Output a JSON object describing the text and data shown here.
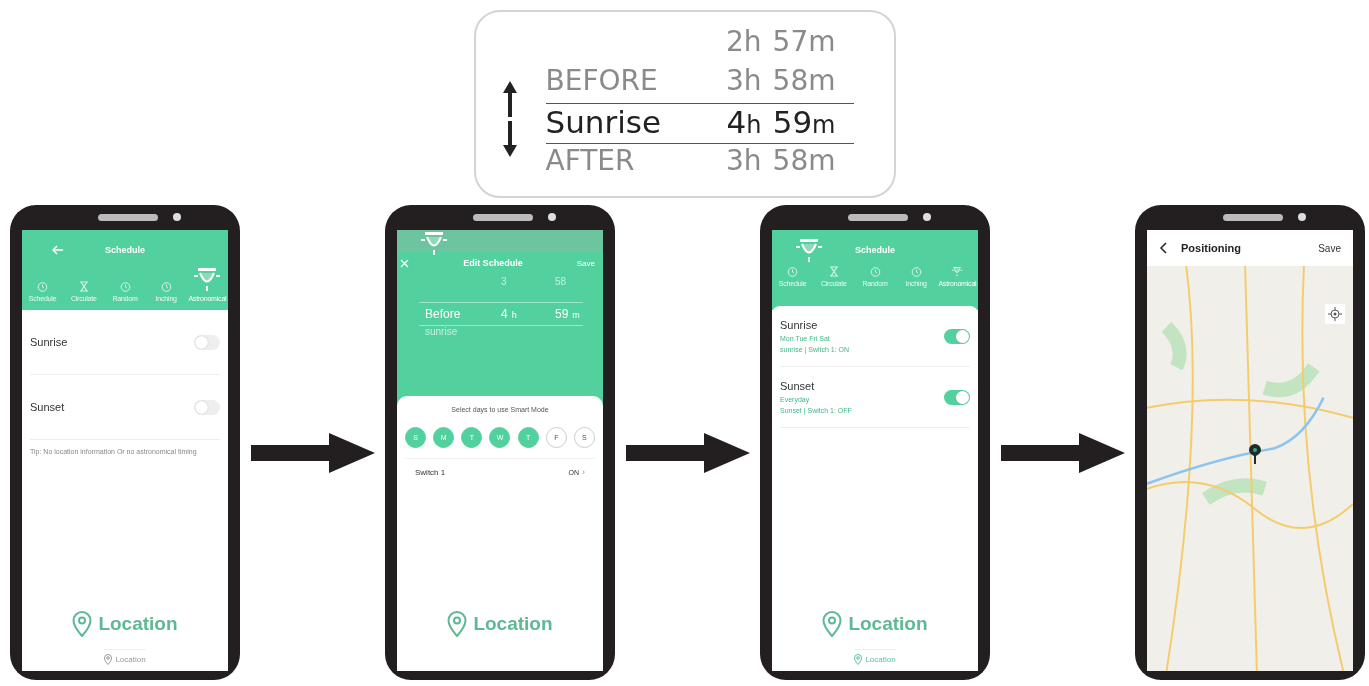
{
  "callout": {
    "rows": [
      {
        "hours": "2",
        "hour_unit": "h",
        "minutes": "57",
        "minute_unit": "m",
        "selected": false
      },
      {
        "label": "BEFORE",
        "hours": "3",
        "hour_unit": "h",
        "minutes": "58",
        "minute_unit": "m",
        "selected": false
      },
      {
        "label": "Sunrise",
        "hours": "4",
        "hour_unit": "h",
        "minutes": "59",
        "minute_unit": "m",
        "selected": true
      },
      {
        "label": "AFTER",
        "hours": "3",
        "hour_unit": "h",
        "minutes": "58",
        "minute_unit": "m",
        "selected": false
      }
    ]
  },
  "phones": [
    {
      "kind": "schedule",
      "title": "Schedule",
      "back": true,
      "tabs": [
        {
          "label": "Schedule",
          "selected": false
        },
        {
          "label": "Circulate",
          "selected": false
        },
        {
          "label": "Random",
          "selected": false
        },
        {
          "label": "Inching",
          "selected": false
        },
        {
          "label": "Astronomical",
          "selected": true
        }
      ],
      "items": [
        {
          "name": "Sunrise",
          "on": false
        },
        {
          "name": "Sunset",
          "on": false
        }
      ],
      "tip": "Tip: No location information Or no astronomical timing",
      "overlay": "Location",
      "location_button": "Location",
      "button_faded": true
    },
    {
      "kind": "edit",
      "title": "Edit Schedule",
      "save": "Save",
      "picker": {
        "above": {
          "hours": "3",
          "minutes": "58"
        },
        "current": {
          "label": "Before",
          "hours": "4",
          "hour_unit": "h",
          "minutes": "59",
          "minute_unit": "m"
        },
        "below": {
          "label": "sunrise"
        }
      },
      "days_title": "Select days to use Smart Mode",
      "days": [
        {
          "label": "S",
          "selected": true
        },
        {
          "label": "M",
          "selected": true
        },
        {
          "label": "T",
          "selected": true
        },
        {
          "label": "W",
          "selected": true
        },
        {
          "label": "T",
          "selected": true
        },
        {
          "label": "F",
          "selected": false
        },
        {
          "label": "S",
          "selected": false
        }
      ],
      "switch_row": {
        "label": "Switch 1",
        "value": "ON",
        "chevron": "›"
      },
      "overlay": "Location"
    },
    {
      "kind": "schedule",
      "title": "Schedule",
      "back": false,
      "tabs": [
        {
          "label": "Schedule",
          "selected": false
        },
        {
          "label": "Circulate",
          "selected": false
        },
        {
          "label": "Random",
          "selected": false
        },
        {
          "label": "Inching",
          "selected": false
        },
        {
          "label": "Astronomical",
          "selected": true
        }
      ],
      "items": [
        {
          "name": "Sunrise",
          "days": "Mon Tue Fri Sat",
          "detail": "sunrise  |  Switch 1: ON",
          "on": true
        },
        {
          "name": "Sunset",
          "days": "Everyday",
          "detail": "Sunset  |  Switch 1: OFF",
          "on": true
        }
      ],
      "overlay": "Location",
      "location_button": "Location",
      "button_faded": false
    },
    {
      "kind": "positioning",
      "title": "Positioning",
      "save": "Save"
    }
  ]
}
